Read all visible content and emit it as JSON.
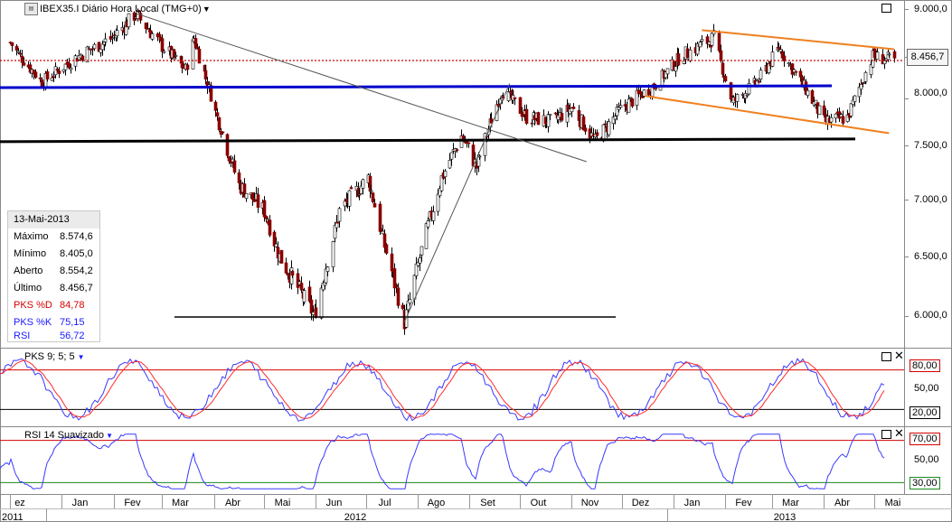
{
  "window": {
    "title": "IBEX35.I Diário Hora Local (TMG+0)",
    "title_icon": "chart-window-icon"
  },
  "info_panel": {
    "date": "13-Mai-2013",
    "rows": [
      {
        "label": "Máximo",
        "value": "8.574,6",
        "color": "#000000"
      },
      {
        "label": "Mínimo",
        "value": "8.405,0",
        "color": "#000000"
      },
      {
        "label": "Aberto",
        "value": "8.554,2",
        "color": "#000000"
      },
      {
        "label": "Último",
        "value": "8.456,7",
        "color": "#000000"
      },
      {
        "label": "PKS %D",
        "value": "84,78",
        "color": "#d40000"
      },
      {
        "label": "PKS %K",
        "value": "75,15",
        "color": "#1a1aff"
      },
      {
        "label": "RSI",
        "value": "56,72",
        "color": "#1a1aff"
      }
    ]
  },
  "last_price_label": "8.456,7",
  "price_axis_labels": [
    "9.000,0",
    "8.500,0",
    "8.000,0",
    "7.500,0",
    "7.000,0",
    "6.500,0",
    "6.000,0"
  ],
  "month_labels": [
    "ez",
    "Jan",
    "Fev",
    "Mar",
    "Abr",
    "Mai",
    "Jun",
    "Jul",
    "Ago",
    "Set",
    "Out",
    "Nov",
    "Dez",
    "Jan",
    "Fev",
    "Mar",
    "Abr",
    "Mai"
  ],
  "year_labels": [
    "2011",
    "2012",
    "2013"
  ],
  "stoch_panel": {
    "title": "PKS 9; 5; 5",
    "levels": [
      "80,00",
      "50,00",
      "20,00"
    ]
  },
  "rsi_panel": {
    "title": "RSI 14 Suavizado",
    "levels": [
      "70,00",
      "50,00",
      "30,00"
    ]
  },
  "colors": {
    "up_candle": "#ffffff",
    "down_candle": "#8a0000",
    "support_blue": "#0000cc",
    "trend_orange": "#f08020",
    "last_price_dotted": "#cc0000",
    "stoch_k": "#3a3aff",
    "stoch_d": "#ff2a2a"
  },
  "chart_data": {
    "type": "candlestick",
    "instrument": "IBEX35.I",
    "period": "Diário",
    "ylim": [
      5750,
      9150
    ],
    "x_range": [
      "Dez 2011",
      "Mai 2013"
    ],
    "close_path": [
      {
        "date": "2011-12-01",
        "close": 8650
      },
      {
        "date": "2011-12-20",
        "close": 8200
      },
      {
        "date": "2012-01-10",
        "close": 8500
      },
      {
        "date": "2012-01-31",
        "close": 8700
      },
      {
        "date": "2012-02-14",
        "close": 8950
      },
      {
        "date": "2012-02-28",
        "close": 8650
      },
      {
        "date": "2012-03-15",
        "close": 8350
      },
      {
        "date": "2012-03-20",
        "close": 8700
      },
      {
        "date": "2012-04-02",
        "close": 7850
      },
      {
        "date": "2012-04-15",
        "close": 7150
      },
      {
        "date": "2012-05-01",
        "close": 6900
      },
      {
        "date": "2012-05-10",
        "close": 6500
      },
      {
        "date": "2012-05-31",
        "close": 6000
      },
      {
        "date": "2012-06-15",
        "close": 6900
      },
      {
        "date": "2012-07-02",
        "close": 7200
      },
      {
        "date": "2012-07-10",
        "close": 6700
      },
      {
        "date": "2012-07-24",
        "close": 5950
      },
      {
        "date": "2012-08-03",
        "close": 6550
      },
      {
        "date": "2012-08-15",
        "close": 7200
      },
      {
        "date": "2012-08-27",
        "close": 7600
      },
      {
        "date": "2012-09-05",
        "close": 7300
      },
      {
        "date": "2012-09-20",
        "close": 8100
      },
      {
        "date": "2012-10-05",
        "close": 7800
      },
      {
        "date": "2012-10-20",
        "close": 7750
      },
      {
        "date": "2012-11-01",
        "close": 7900
      },
      {
        "date": "2012-11-15",
        "close": 7550
      },
      {
        "date": "2012-12-01",
        "close": 7900
      },
      {
        "date": "2012-12-20",
        "close": 8150
      },
      {
        "date": "2013-01-05",
        "close": 8500
      },
      {
        "date": "2013-01-25",
        "close": 8700
      },
      {
        "date": "2013-02-05",
        "close": 7950
      },
      {
        "date": "2013-02-20",
        "close": 8200
      },
      {
        "date": "2013-03-05",
        "close": 8600
      },
      {
        "date": "2013-03-15",
        "close": 8300
      },
      {
        "date": "2013-04-01",
        "close": 7750
      },
      {
        "date": "2013-04-15",
        "close": 7800
      },
      {
        "date": "2013-04-30",
        "close": 8500
      },
      {
        "date": "2013-05-13",
        "close": 8456.7
      }
    ],
    "horizontal_lines": [
      {
        "name": "last",
        "value": 8456.7,
        "style": "dotted",
        "color": "#cc0000"
      },
      {
        "name": "blue support",
        "value": 8130,
        "color": "#0000cc"
      },
      {
        "name": "black support",
        "value": 7540,
        "color": "#000000"
      },
      {
        "name": "bottom support",
        "value": 6000,
        "color": "#000000"
      }
    ],
    "trendlines": [
      {
        "name": "down trend",
        "from": [
          "2012-02-15",
          8950
        ],
        "to": [
          "2012-11-10",
          7350
        ],
        "color": "#555555"
      },
      {
        "name": "up trend",
        "from": [
          "2012-07-24",
          5950
        ],
        "to": [
          "2012-09-25",
          8180
        ],
        "color": "#555555"
      },
      {
        "name": "channel top",
        "from": [
          "2013-01-18",
          8780
        ],
        "to": [
          "2013-05-13",
          8580
        ],
        "color": "#f08020"
      },
      {
        "name": "channel bottom",
        "from": [
          "2012-12-15",
          8030
        ],
        "to": [
          "2013-05-10",
          7630
        ],
        "color": "#f08020"
      }
    ],
    "stoch_levels": [
      80,
      50,
      20
    ],
    "rsi_levels": [
      70,
      50,
      30
    ],
    "rsi_range": [
      20,
      80
    ]
  }
}
